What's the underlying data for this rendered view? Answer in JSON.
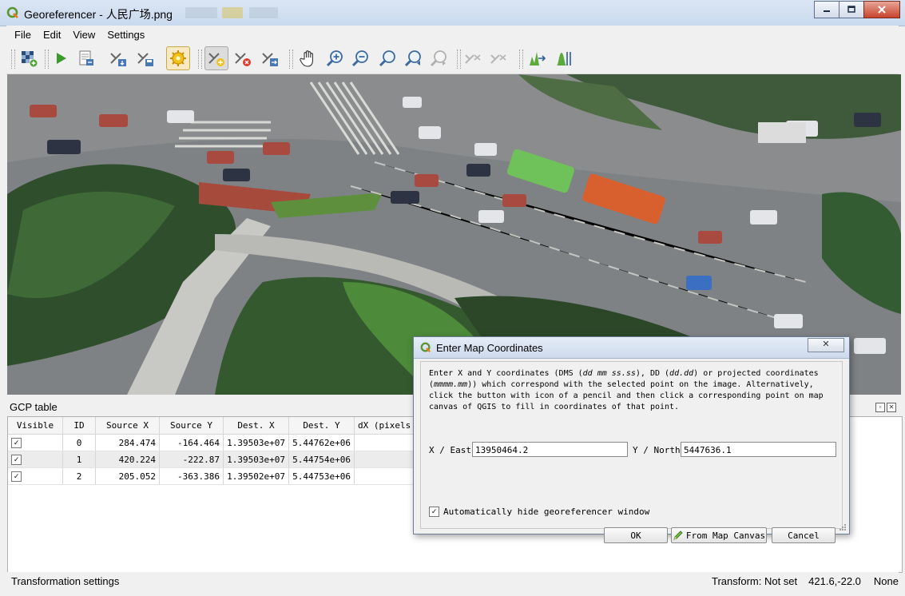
{
  "window": {
    "title": "Georeferencer - 人民广场.png",
    "minimize_icon": "minimize-icon",
    "maximize_icon": "maximize-icon",
    "close_icon": "close-icon"
  },
  "menu": [
    "File",
    "Edit",
    "View",
    "Settings"
  ],
  "toolbar": {
    "buttons": [
      "open-raster-icon",
      "start-georeferencing-icon",
      "generate-gdal-script-icon",
      "load-gcp-points-icon",
      "save-gcp-points-icon",
      "transformation-settings-icon",
      "add-point-icon",
      "delete-point-icon",
      "move-gcp-point-icon",
      "pan-icon",
      "zoom-in-icon",
      "zoom-out-icon",
      "zoom-to-layer-icon",
      "zoom-last-icon",
      "zoom-next-icon",
      "link-georeferencer-to-qgis-icon",
      "link-qgis-to-georeferencer-icon",
      "full-histogram-stretch-icon",
      "local-histogram-stretch-icon"
    ]
  },
  "gcp_panel": {
    "title": "GCP table",
    "columns": [
      "Visible",
      "ID",
      "Source X",
      "Source Y",
      "Dest. X",
      "Dest. Y",
      "dX (pixels"
    ],
    "rows": [
      {
        "visible": "✓",
        "id": "0",
        "source_x": "284.474",
        "source_y": "-164.464",
        "dest_x": "1.39503e+07",
        "dest_y": "5.44762e+06"
      },
      {
        "visible": "✓",
        "id": "1",
        "source_x": "420.224",
        "source_y": "-222.87",
        "dest_x": "1.39503e+07",
        "dest_y": "5.44754e+06"
      },
      {
        "visible": "✓",
        "id": "2",
        "source_x": "205.052",
        "source_y": "-363.386",
        "dest_x": "1.39502e+07",
        "dest_y": "5.44753e+06"
      }
    ]
  },
  "status": {
    "left": "Transformation settings",
    "transform": "Transform: Not set",
    "coords": "421.6,-22.0",
    "crs": "None"
  },
  "dialog": {
    "title": "Enter Map Coordinates",
    "close_label": "✕",
    "desc_1": "Enter X and Y coordinates (DMS (",
    "desc_1_em": "dd mm ss.ss",
    "desc_2": "), DD (",
    "desc_2_em": "dd.dd",
    "desc_3": ") or projected coordinates (",
    "desc_3_em": "mmmm.mm",
    "desc_4": ")) which correspond with the selected point on the image. Alternatively, click the button with icon of a pencil and then click a corresponding point on map canvas of QGIS to fill in coordinates of that point.",
    "x_label": "X / East",
    "x_value": "13950464.2",
    "y_label": "Y / North",
    "y_value": "5447636.1",
    "autohide_label": "Automatically hide georeferencer window",
    "autohide_checked": "✓",
    "ok_label": "OK",
    "from_canvas_label": "From Map Canvas",
    "cancel_label": "Cancel"
  }
}
